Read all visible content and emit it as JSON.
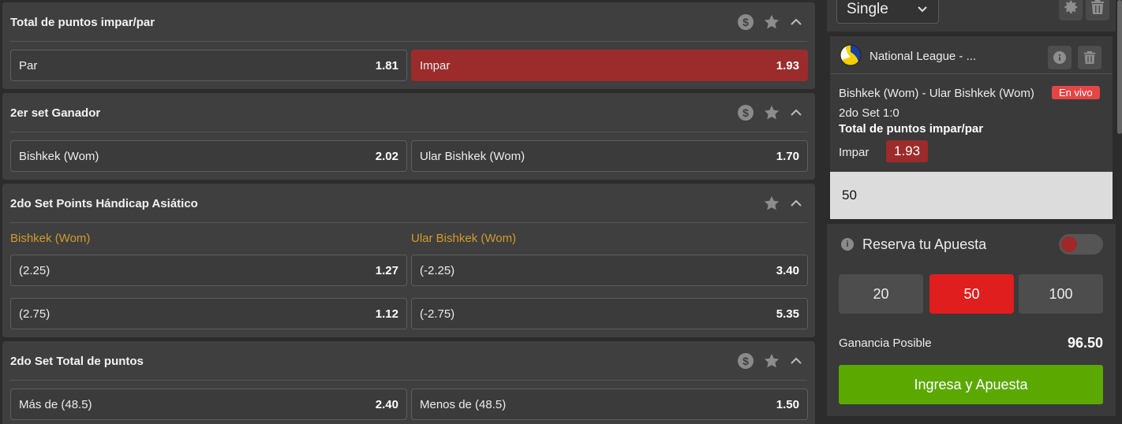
{
  "markets": [
    {
      "title": "Total de puntos impar/par",
      "has_cashout": true,
      "rows": [
        [
          {
            "label": "Par",
            "odd": "1.81",
            "selected": false
          },
          {
            "label": "Impar",
            "odd": "1.93",
            "selected": true
          }
        ]
      ]
    },
    {
      "title": "2er set Ganador",
      "has_cashout": true,
      "rows": [
        [
          {
            "label": "Bishkek (Wom)",
            "odd": "2.02",
            "selected": false
          },
          {
            "label": "Ular Bishkek (Wom)",
            "odd": "1.70",
            "selected": false
          }
        ]
      ]
    },
    {
      "title": "2do Set Points Hándicap Asiático",
      "has_cashout": false,
      "subheads": [
        "Bishkek (Wom)",
        "Ular Bishkek (Wom)"
      ],
      "rows": [
        [
          {
            "label": "(2.25)",
            "odd": "1.27",
            "selected": false
          },
          {
            "label": "(-2.25)",
            "odd": "3.40",
            "selected": false
          }
        ],
        [
          {
            "label": "(2.75)",
            "odd": "1.12",
            "selected": false
          },
          {
            "label": "(-2.75)",
            "odd": "5.35",
            "selected": false
          }
        ]
      ]
    },
    {
      "title": "2do Set Total de puntos",
      "has_cashout": true,
      "rows": [
        [
          {
            "label": "Más de (48.5)",
            "odd": "2.40",
            "selected": false
          },
          {
            "label": "Menos de (48.5)",
            "odd": "1.50",
            "selected": false
          }
        ]
      ]
    }
  ],
  "betslip": {
    "mode": "Single",
    "bet": {
      "league": "National League - ...",
      "match": "Bishkek (Wom) - Ular Bishkek (Wom)",
      "live_badge": "En vivo",
      "score": "2do Set 1:0",
      "market": "Total de puntos impar/par",
      "selection": "Impar",
      "odd": "1.93",
      "stake": "50"
    },
    "reserve_label": "Reserva tu Apuesta",
    "quick_stakes": [
      "20",
      "50",
      "100"
    ],
    "quick_stake_selected": "50",
    "gain_label": "Ganancia Posible",
    "gain_value": "96.50",
    "cta_label": "Ingresa y Apuesta"
  },
  "colors": {
    "selected_odd": "#9c2b2b",
    "accent_red": "#e01e1e",
    "live_badge": "#e64545",
    "cta_green": "#5aa800",
    "subhead_gold": "#d49a2a"
  }
}
